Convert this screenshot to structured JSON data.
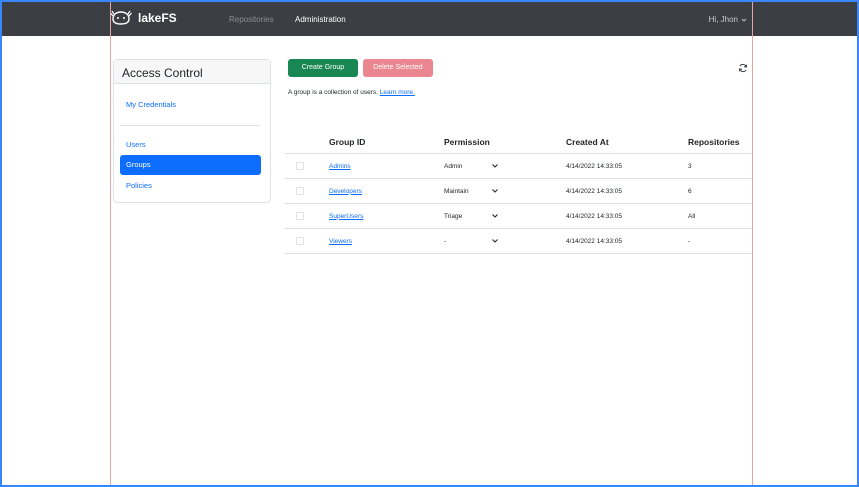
{
  "header": {
    "brand": "lakeFS",
    "nav": [
      "Repositories",
      "Administration"
    ],
    "user": "Hi, Jhon"
  },
  "sidebar": {
    "title": "Access Control",
    "items": [
      {
        "label": "My Credentials",
        "active": false
      },
      {
        "label": "Users",
        "active": false
      },
      {
        "label": "Groups",
        "active": true
      },
      {
        "label": "Policies",
        "active": false
      }
    ]
  },
  "toolbar": {
    "create_label": "Create Group",
    "delete_label": "Delete Selected"
  },
  "description": {
    "text": "A group is a collection of users.",
    "link": "Learn more."
  },
  "table": {
    "columns": [
      "Group ID",
      "Permission",
      "Created At",
      "Repositories"
    ],
    "rows": [
      {
        "id": "Admins",
        "permission": "Admin",
        "created": "4/14/2022 14:33:05",
        "repos": "3"
      },
      {
        "id": "Developers",
        "permission": "Maintain",
        "created": "4/14/2022 14:33:05",
        "repos": "6"
      },
      {
        "id": "SuperUsers",
        "permission": "Triage",
        "created": "4/14/2022 14:33:05",
        "repos": "All"
      },
      {
        "id": "Viewers",
        "permission": "-",
        "created": "4/14/2022 14:33:05",
        "repos": "-"
      }
    ]
  },
  "colors": {
    "navbar": "#3b3e42",
    "primary": "#0d6efd",
    "success": "#198754",
    "danger_disabled": "#ea868f",
    "frame": "#3a86ff"
  },
  "icons": {
    "logo": "axolotl-logo-icon",
    "refresh": "refresh-icon",
    "chevron": "chevron-down-icon"
  }
}
